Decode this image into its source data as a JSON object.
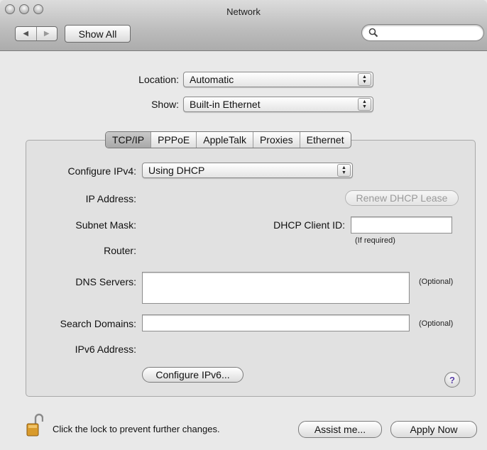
{
  "window": {
    "title": "Network"
  },
  "toolbar": {
    "show_all_label": "Show All",
    "search_placeholder": "",
    "search_value": ""
  },
  "location": {
    "label": "Location:",
    "value": "Automatic"
  },
  "show": {
    "label": "Show:",
    "value": "Built-in Ethernet"
  },
  "tabs": [
    {
      "label": "TCP/IP",
      "active": true
    },
    {
      "label": "PPPoE",
      "active": false
    },
    {
      "label": "AppleTalk",
      "active": false
    },
    {
      "label": "Proxies",
      "active": false
    },
    {
      "label": "Ethernet",
      "active": false
    }
  ],
  "tcpip": {
    "configure_label": "Configure IPv4:",
    "configure_value": "Using DHCP",
    "ip_address_label": "IP Address:",
    "renew_label": "Renew DHCP Lease",
    "subnet_label": "Subnet Mask:",
    "dhcp_client_label": "DHCP Client ID:",
    "dhcp_client_value": "",
    "if_required": "(If required)",
    "router_label": "Router:",
    "dns_label": "DNS Servers:",
    "dns_value": "",
    "dns_optional": "(Optional)",
    "search_domains_label": "Search Domains:",
    "search_domains_value": "",
    "search_optional": "(Optional)",
    "ipv6_label": "IPv6 Address:",
    "configure_ipv6_label": "Configure IPv6...",
    "help_label": "?"
  },
  "footer": {
    "lock_text": "Click the lock to prevent further changes.",
    "assist_label": "Assist me...",
    "apply_label": "Apply Now"
  },
  "icons": {
    "back": "back-arrow-icon",
    "forward": "forward-arrow-icon",
    "search": "magnifier-icon",
    "lock": "lock-icon",
    "help": "help-icon"
  }
}
